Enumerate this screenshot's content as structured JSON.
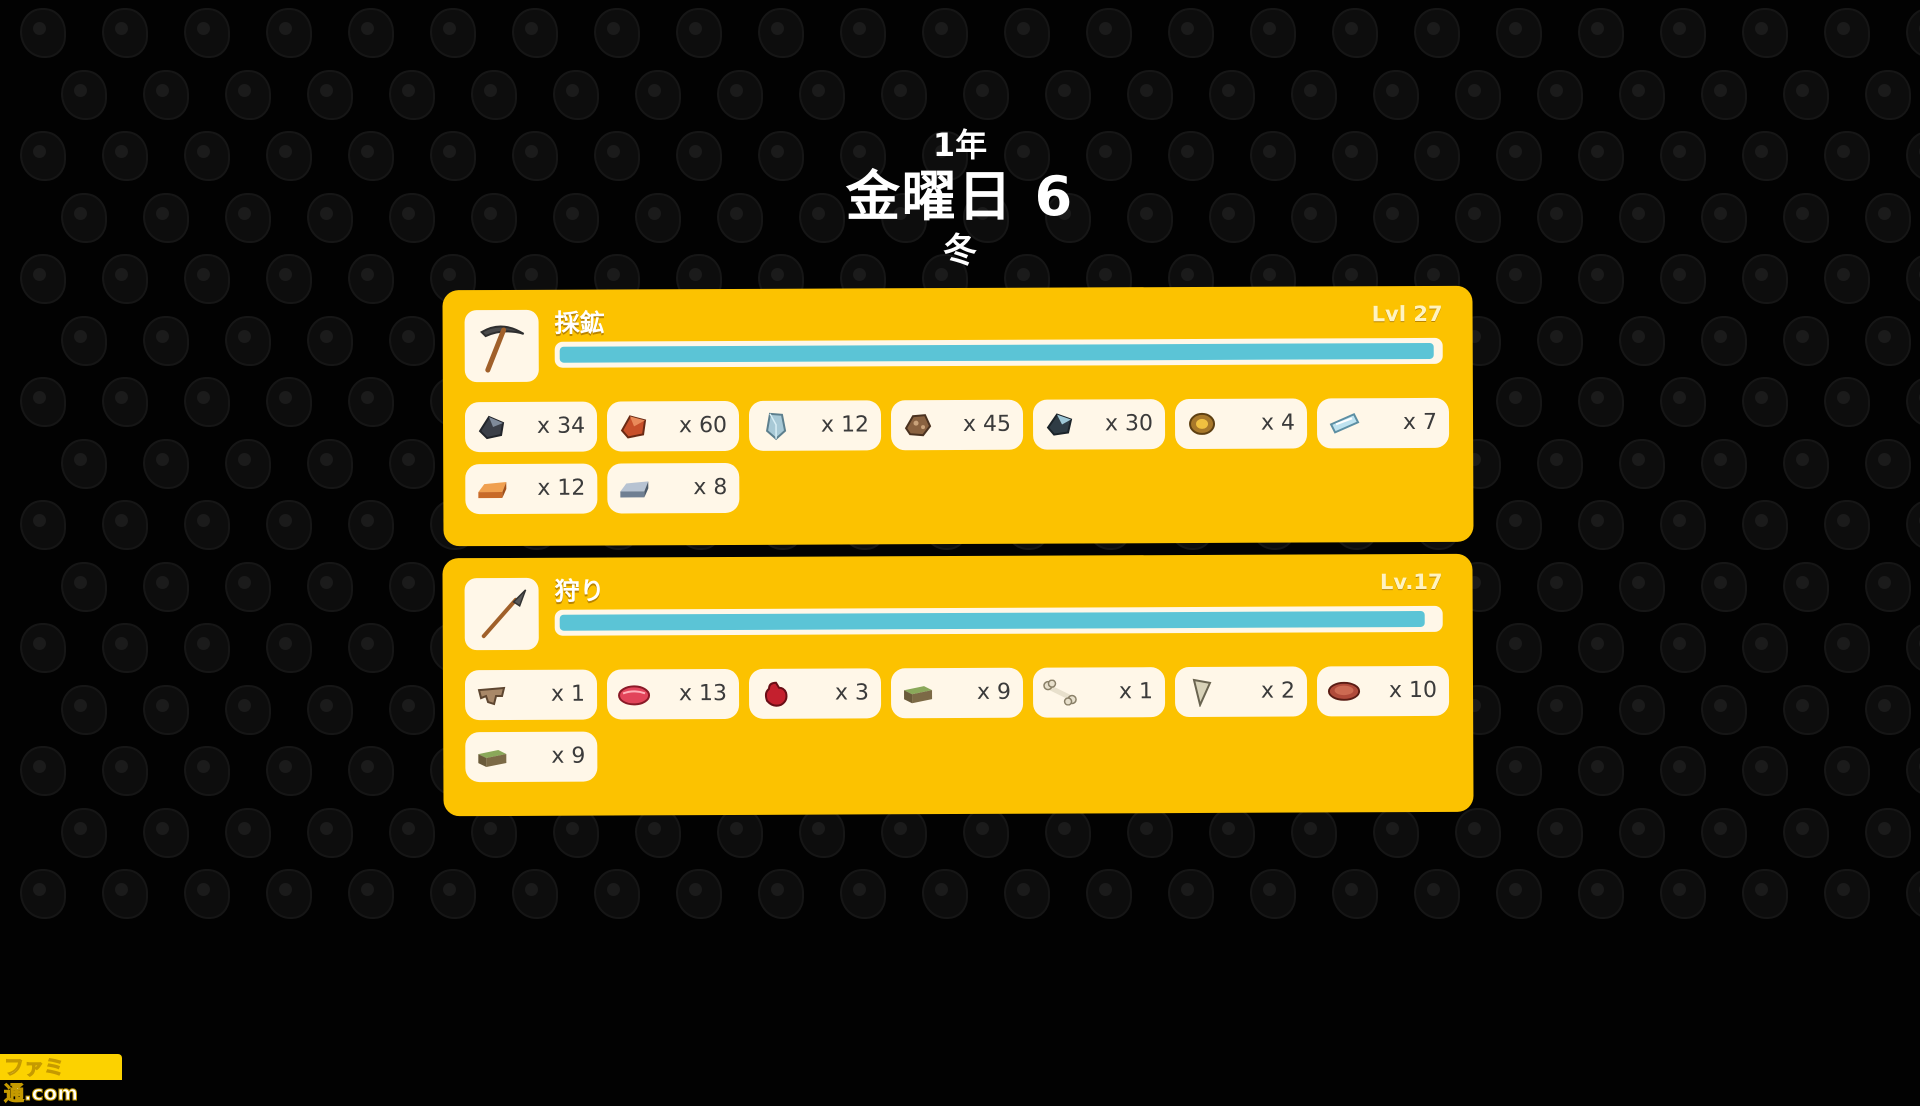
{
  "date": {
    "year": "1年",
    "day": "金曜日 6",
    "season": "冬"
  },
  "colors": {
    "panel": "#fcc200",
    "chip": "#fff7e8",
    "xp_bar": "#5bc4d6",
    "background": "#020202"
  },
  "skills": [
    {
      "name": "採鉱",
      "level": "Lvl 27",
      "tool_icon": "pickaxe-icon",
      "xp_fraction": 0.995,
      "items": [
        {
          "icon": "coal-ore-icon",
          "count": "x 34"
        },
        {
          "icon": "copper-ore-icon",
          "count": "x 60"
        },
        {
          "icon": "crystal-icon",
          "count": "x 12"
        },
        {
          "icon": "iron-ore-icon",
          "count": "x 45"
        },
        {
          "icon": "tin-ore-icon",
          "count": "x 30"
        },
        {
          "icon": "gold-nugget-icon",
          "count": "x 4"
        },
        {
          "icon": "ice-crystal-icon",
          "count": "x 7"
        },
        {
          "icon": "copper-bar-icon",
          "count": "x 12"
        },
        {
          "icon": "iron-bar-icon",
          "count": "x 8"
        }
      ]
    },
    {
      "name": "狩り",
      "level": "Lv.17",
      "tool_icon": "spear-icon",
      "xp_fraction": 0.985,
      "items": [
        {
          "icon": "hide-icon",
          "count": "x 1"
        },
        {
          "icon": "raw-meat-icon",
          "count": "x 13"
        },
        {
          "icon": "heart-organ-icon",
          "count": "x 3"
        },
        {
          "icon": "moss-block-icon",
          "count": "x 9"
        },
        {
          "icon": "bone-icon",
          "count": "x 1"
        },
        {
          "icon": "tooth-icon",
          "count": "x 2"
        },
        {
          "icon": "steak-icon",
          "count": "x 10"
        },
        {
          "icon": "moss-block-icon",
          "count": "x 9"
        }
      ]
    }
  ],
  "watermark": "ファミ通.com"
}
